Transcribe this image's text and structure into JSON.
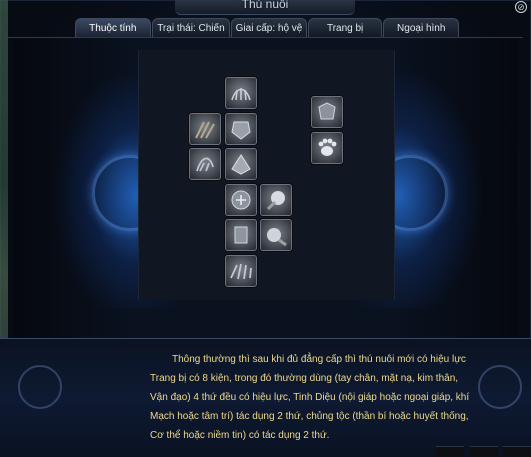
{
  "window": {
    "title": "Thú nuôi",
    "close_icon": "close-icon"
  },
  "tabs": [
    {
      "label": "Thuộc tính",
      "active": true
    },
    {
      "label": "Trại thái: Chiến",
      "active": false
    },
    {
      "label": "Giai cấp: hộ vệ",
      "active": false
    },
    {
      "label": "Trang bị",
      "active": false
    },
    {
      "label": "Ngoại hình",
      "active": false
    }
  ],
  "equipment_slots": [
    {
      "name": "slot-head",
      "icon": "claw-icon"
    },
    {
      "name": "slot-left-1",
      "icon": "claw-icon"
    },
    {
      "name": "slot-center-1",
      "icon": "armor-icon"
    },
    {
      "name": "slot-left-2",
      "icon": "claw-icon"
    },
    {
      "name": "slot-center-2",
      "icon": "armor-icon"
    },
    {
      "name": "slot-center-3",
      "icon": "armor-icon"
    },
    {
      "name": "slot-right-1",
      "icon": "orb-icon"
    },
    {
      "name": "slot-center-4",
      "icon": "armor-icon"
    },
    {
      "name": "slot-right-2",
      "icon": "orb-icon"
    },
    {
      "name": "slot-feet",
      "icon": "paw-icon"
    },
    {
      "name": "slot-extra-1",
      "icon": "armor-icon"
    },
    {
      "name": "slot-extra-2",
      "icon": "paw-print-icon"
    }
  ],
  "description": {
    "line1": "Thông thường thì sau khi đủ đẳng cấp thì thú nuôi mới có hiệu lực",
    "line2": "Trang bị có 8 kiện, trong đó thường dùng (tay chân, mặt nạ, kim thân,",
    "line3": "Vận đạo) 4 thứ đều có hiệu lực, Tinh Diệu (nội giáp hoặc ngoại giáp, khí",
    "line4": "Mạch hoặc tâm trí) tác dụng 2 thứ, chủng tộc (thần bí hoặc huyết thống,",
    "line5": "Cơ thể hoặc niềm tin) có tác dụng 2 thứ."
  },
  "colors": {
    "accent_glow": "#2878e6",
    "text_description": "#efd98a",
    "panel_bg": "#0a1220"
  }
}
